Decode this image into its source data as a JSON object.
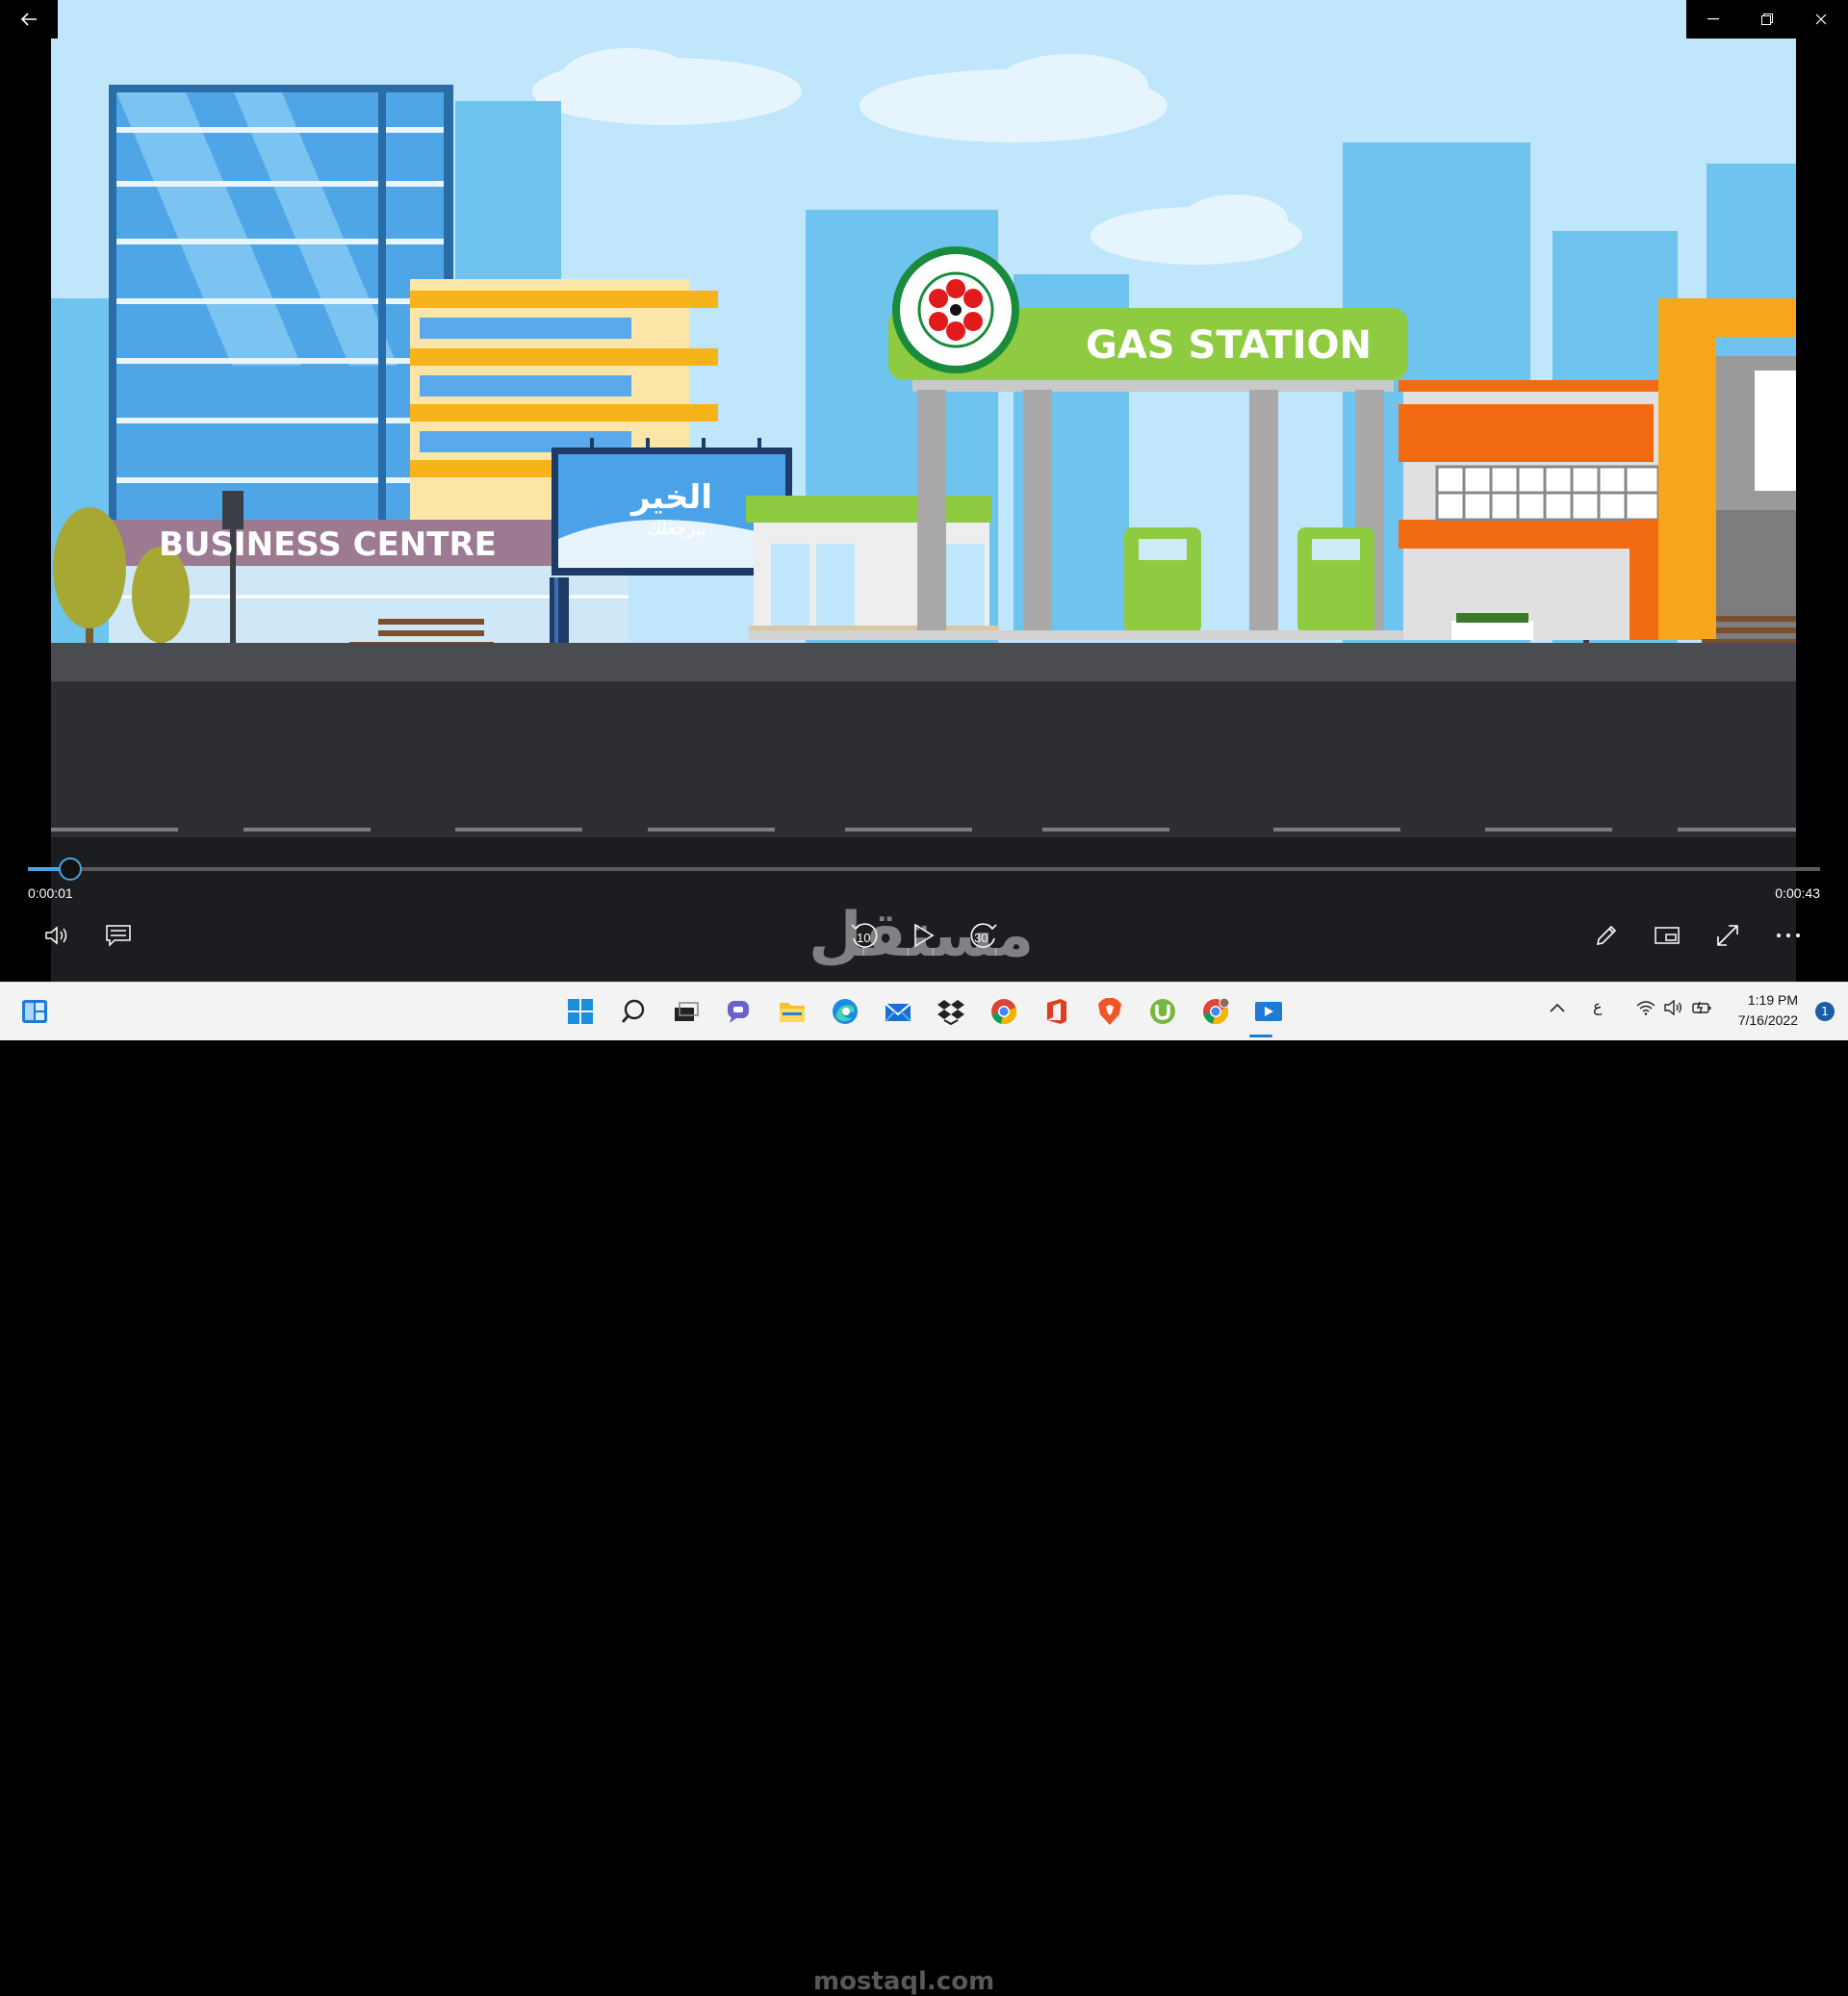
{
  "video": {
    "sign_business": "BUSINESS CENTRE",
    "sign_gas": "GAS STATION",
    "billboard_line1": "الخير",
    "billboard_line2": "بيرجعلك"
  },
  "player": {
    "time_current": "0:00:01",
    "time_total": "0:00:43",
    "progress_fraction": 0.023,
    "skip_back_seconds": "10",
    "skip_forward_seconds": "30",
    "accent_color": "#4ba3e3"
  },
  "icons": {
    "back": "back-arrow-icon",
    "minimize": "minimize-icon",
    "restore": "restore-icon",
    "close": "close-icon",
    "volume": "volume-icon",
    "captions": "captions-icon",
    "play": "play-icon",
    "edit": "pencil-icon",
    "miniplayer": "miniplayer-icon",
    "fullscreen": "fullscreen-icon",
    "more": "more-icon"
  },
  "watermark": {
    "text": "مستقل",
    "subtext": "mostaql.com"
  },
  "taskbar": {
    "lang": "ع",
    "time": "1:19 PM",
    "date": "7/16/2022",
    "notifications": "1"
  }
}
